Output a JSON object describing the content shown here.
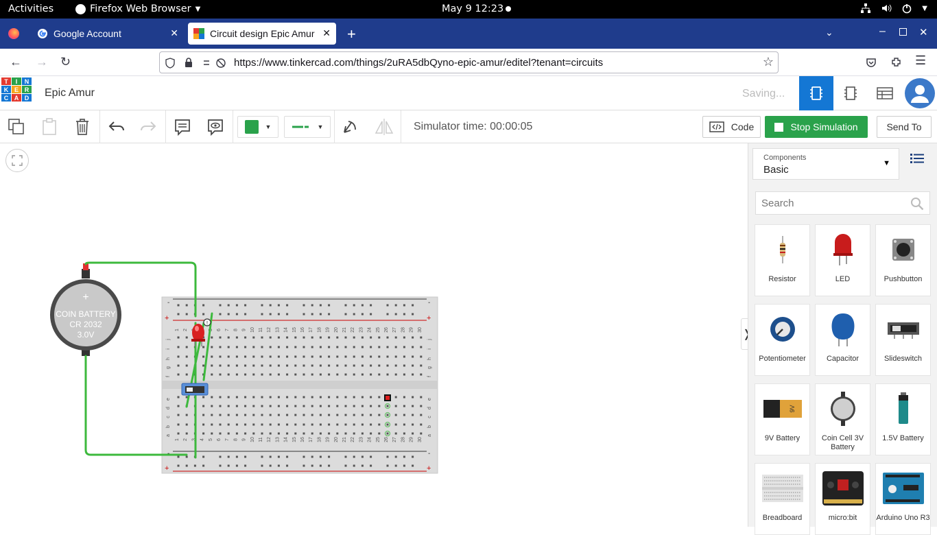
{
  "system_bar": {
    "activities": "Activities",
    "app_name": "Firefox Web Browser",
    "clock": "May 9  12:23"
  },
  "browser": {
    "tabs": [
      {
        "title": "Google Account"
      },
      {
        "title": "Circuit design Epic Amur"
      }
    ],
    "url": "https://www.tinkercad.com/things/2uRA5dbQyno-epic-amur/editel?tenant=circuits"
  },
  "app": {
    "logo_letters": [
      "T",
      "I",
      "N",
      "K",
      "E",
      "R",
      "C",
      "A",
      "D"
    ],
    "project_title": "Epic Amur",
    "status": "Saving...",
    "simulator_time": "Simulator time: 00:00:05",
    "code_label": "Code",
    "stop_label": "Stop Simulation",
    "send_label": "Send To",
    "accent_green": "#2aa24b",
    "accent_blue": "#1477d4"
  },
  "canvas": {
    "battery_lines": [
      "COIN BATTERY",
      "CR 2032",
      "3.0V"
    ],
    "breadboard_rows_top": [
      "j",
      "i",
      "h",
      "g",
      "f"
    ],
    "breadboard_rows_bottom": [
      "e",
      "d",
      "c",
      "b",
      "a"
    ],
    "column_labels": [
      "1",
      "2",
      "3",
      "4",
      "5",
      "6",
      "7",
      "8",
      "9",
      "10",
      "11",
      "12",
      "13",
      "14",
      "15",
      "16",
      "17",
      "18",
      "19",
      "20",
      "21",
      "22",
      "23",
      "24",
      "25",
      "26",
      "27",
      "28",
      "29",
      "30"
    ],
    "rail_plus": "+",
    "rail_minus": "-"
  },
  "panel": {
    "components_label": "Components",
    "components_value": "Basic",
    "search_placeholder": "Search",
    "components": [
      {
        "name": "Resistor",
        "icon": "resistor-icon"
      },
      {
        "name": "LED",
        "icon": "led-icon"
      },
      {
        "name": "Pushbutton",
        "icon": "pushbutton-icon"
      },
      {
        "name": "Potentiometer",
        "icon": "potentiometer-icon"
      },
      {
        "name": "Capacitor",
        "icon": "capacitor-icon"
      },
      {
        "name": "Slideswitch",
        "icon": "slideswitch-icon"
      },
      {
        "name": "9V Battery",
        "icon": "battery-9v-icon"
      },
      {
        "name": "Coin Cell 3V Battery",
        "icon": "coin-cell-icon"
      },
      {
        "name": "1.5V Battery",
        "icon": "battery-aa-icon"
      },
      {
        "name": "Breadboard",
        "icon": "breadboard-icon"
      },
      {
        "name": "micro:bit",
        "icon": "microbit-icon"
      },
      {
        "name": "Arduino Uno R3",
        "icon": "arduino-icon"
      }
    ]
  }
}
